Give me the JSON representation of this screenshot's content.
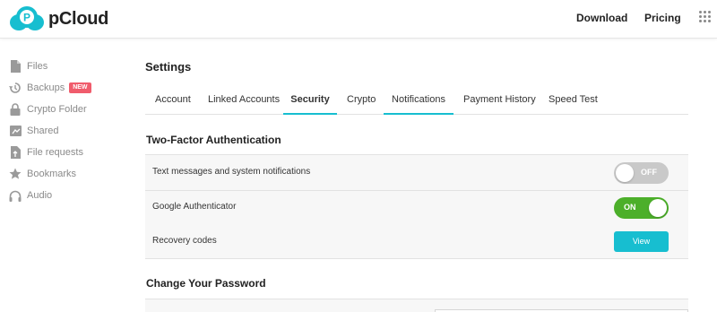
{
  "header": {
    "brand": "pCloud",
    "nav": {
      "download": "Download",
      "pricing": "Pricing"
    }
  },
  "sidebar": {
    "items": [
      {
        "label": "Files",
        "icon": "file-icon"
      },
      {
        "label": "Backups",
        "icon": "backup-icon",
        "badge": "NEW"
      },
      {
        "label": "Crypto Folder",
        "icon": "lock-icon"
      },
      {
        "label": "Shared",
        "icon": "shared-icon"
      },
      {
        "label": "File requests",
        "icon": "file-request-icon"
      },
      {
        "label": "Bookmarks",
        "icon": "star-icon"
      },
      {
        "label": "Audio",
        "icon": "headphones-icon"
      }
    ]
  },
  "main": {
    "title": "Settings",
    "tabs": [
      "Account",
      "Linked Accounts",
      "Security",
      "Crypto",
      "Notifications",
      "Payment History",
      "Speed Test"
    ],
    "active_tab": "Security",
    "two_factor": {
      "title": "Two-Factor Authentication",
      "rows": [
        {
          "label": "Text messages and system notifications",
          "toggle": "OFF"
        },
        {
          "label": "Google Authenticator",
          "toggle": "ON"
        },
        {
          "label": "Recovery codes",
          "button": "View"
        }
      ]
    },
    "password": {
      "title": "Change Your Password"
    }
  },
  "colors": {
    "accent": "#17bed0",
    "toggle_on": "#4caf2a",
    "toggle_off": "#c9c9c9",
    "badge": "#f05c6c"
  }
}
